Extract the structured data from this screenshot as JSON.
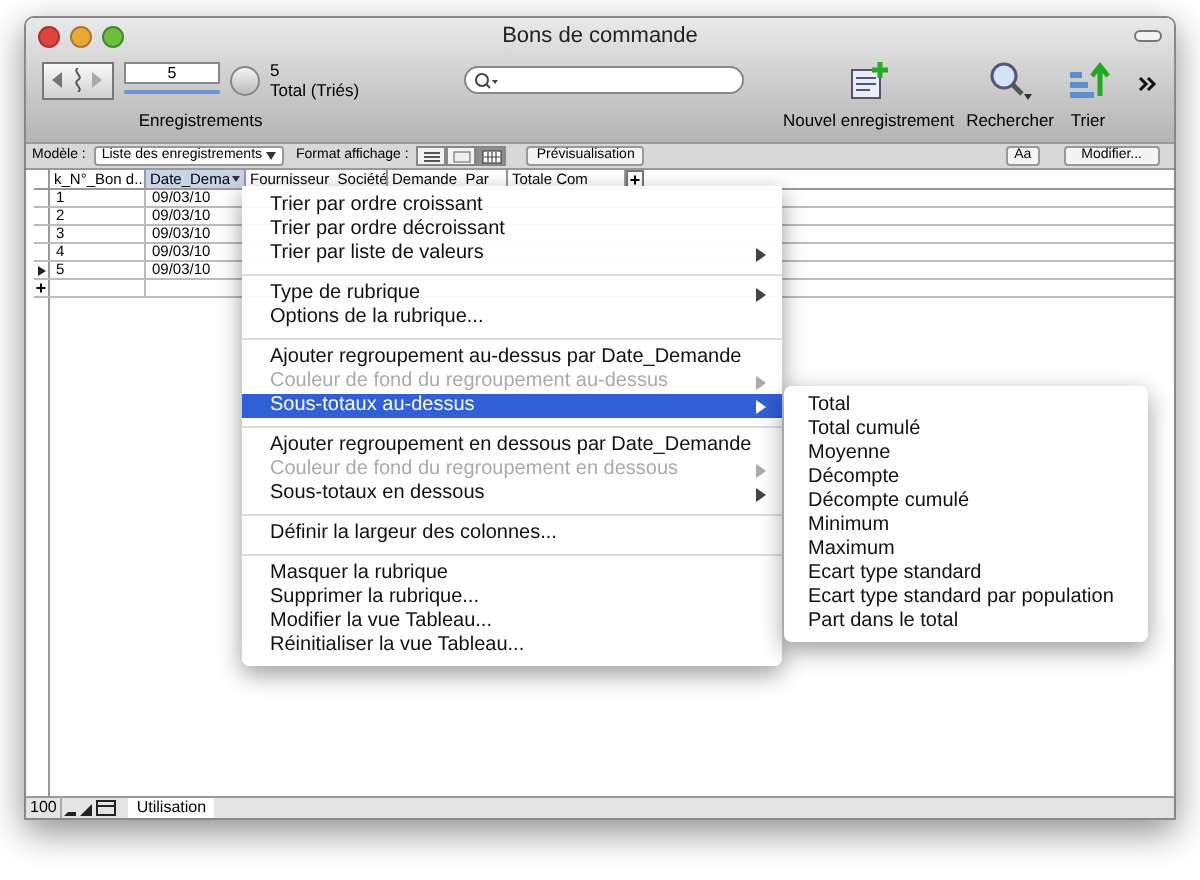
{
  "window": {
    "title": "Bons de commande"
  },
  "toolbar": {
    "record_field": "5",
    "record_slider": {
      "level": 1
    },
    "record_count": "5",
    "record_status": "Total (Triés)",
    "records_label": "Enregistrements",
    "buttons": [
      {
        "label": "Nouvel enregistrement",
        "kind": "new"
      },
      {
        "label": "Rechercher",
        "kind": "find"
      },
      {
        "label": "Trier",
        "kind": "sort"
      }
    ]
  },
  "layout_bar": {
    "layout_label": "Modèle :",
    "layout_value": "Liste des enregistrements",
    "view_label": "Format affichage :",
    "views": [
      {
        "kind": "form",
        "selected": false
      },
      {
        "kind": "list",
        "selected": false
      },
      {
        "kind": "table",
        "selected": true
      }
    ],
    "preview_button": "Prévisualisation",
    "font_button": "Aa",
    "edit_button": "Modifier..."
  },
  "table": {
    "columns": [
      {
        "label": "k_N°_Bon d...",
        "selected": false
      },
      {
        "label": "Date_Dema",
        "selected": true
      },
      {
        "label": "Fournisseur_Société",
        "selected": false
      },
      {
        "label": "Demande_Par",
        "selected": false
      },
      {
        "label": "Totale Com",
        "selected": false
      }
    ],
    "add_column": "+",
    "rows": [
      {
        "cells": [
          "1",
          "09/03/10"
        ],
        "current": false
      },
      {
        "cells": [
          "2",
          "09/03/10"
        ],
        "current": false
      },
      {
        "cells": [
          "3",
          "09/03/10"
        ],
        "current": false
      },
      {
        "cells": [
          "4",
          "09/03/10"
        ],
        "current": false
      },
      {
        "cells": [
          "5",
          "09/03/10"
        ],
        "current": true
      }
    ],
    "add_row": "+"
  },
  "menu": {
    "items": [
      {
        "kind": "item",
        "label": "Trier par ordre croissant",
        "disabled": false,
        "selected": false
      },
      {
        "kind": "item",
        "label": "Trier par ordre décroissant",
        "disabled": false,
        "selected": false
      },
      {
        "kind": "submenu",
        "label": "Trier par liste de valeurs",
        "disabled": false,
        "selected": false
      },
      {
        "kind": "separator"
      },
      {
        "kind": "submenu",
        "label": "Type de rubrique",
        "disabled": false,
        "selected": false
      },
      {
        "kind": "item",
        "label": "Options de la rubrique...",
        "disabled": false,
        "selected": false
      },
      {
        "kind": "separator"
      },
      {
        "kind": "item",
        "label": "Ajouter regroupement au-dessus par Date_Demande",
        "disabled": false,
        "selected": false
      },
      {
        "kind": "submenu",
        "label": "Couleur de fond du regroupement au-dessus",
        "disabled": true,
        "selected": false
      },
      {
        "kind": "submenu",
        "label": "Sous-totaux au-dessus",
        "disabled": false,
        "selected": true
      },
      {
        "kind": "separator"
      },
      {
        "kind": "item",
        "label": "Ajouter regroupement en dessous par Date_Demande",
        "disabled": false,
        "selected": false
      },
      {
        "kind": "submenu",
        "label": "Couleur de fond du regroupement en dessous",
        "disabled": true,
        "selected": false
      },
      {
        "kind": "submenu",
        "label": "Sous-totaux en dessous",
        "disabled": false,
        "selected": false
      },
      {
        "kind": "separator"
      },
      {
        "kind": "item",
        "label": "Définir la largeur des colonnes...",
        "disabled": false,
        "selected": false
      },
      {
        "kind": "separator"
      },
      {
        "kind": "item",
        "label": "Masquer la rubrique",
        "disabled": false,
        "selected": false
      },
      {
        "kind": "item",
        "label": "Supprimer la rubrique...",
        "disabled": false,
        "selected": false
      },
      {
        "kind": "item",
        "label": "Modifier la vue Tableau...",
        "disabled": false,
        "selected": false
      },
      {
        "kind": "item",
        "label": "Réinitialiser la vue Tableau...",
        "disabled": false,
        "selected": false
      }
    ]
  },
  "submenu": {
    "items": [
      "Total",
      "Total cumulé",
      "Moyenne",
      "Décompte",
      "Décompte cumulé",
      "Minimum",
      "Maximum",
      "Ecart type standard",
      "Ecart type standard par population",
      "Part dans le total"
    ]
  },
  "status_bar": {
    "zoom": "100",
    "mode": "Utilisation"
  }
}
